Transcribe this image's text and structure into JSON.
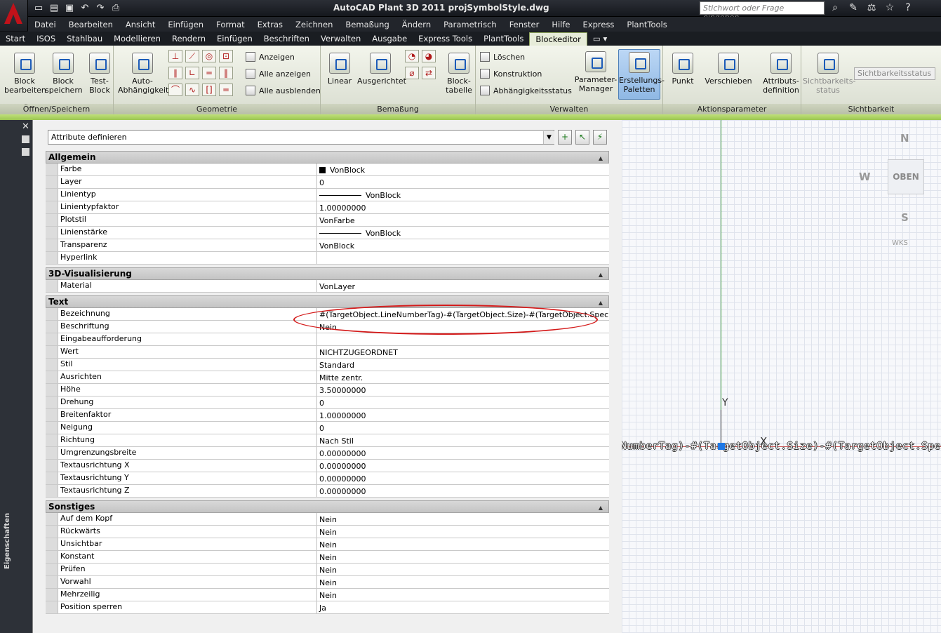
{
  "window": {
    "title": "AutoCAD Plant 3D 2011   projSymbolStyle.dwg",
    "search_placeholder": "Stichwort oder Frage eingeben"
  },
  "menu": [
    "Datei",
    "Bearbeiten",
    "Ansicht",
    "Einfügen",
    "Format",
    "Extras",
    "Zeichnen",
    "Bemaßung",
    "Ändern",
    "Parametrisch",
    "Fenster",
    "Hilfe",
    "Express",
    "PlantTools"
  ],
  "tabs": [
    "Start",
    "ISOS",
    "Stahlbau",
    "Modellieren",
    "Rendern",
    "Einfügen",
    "Beschriften",
    "Verwalten",
    "Ausgabe",
    "Express Tools",
    "PlantTools",
    "Blockeditor"
  ],
  "ribbon": {
    "block_edit": "Block bearbeiten",
    "block_save": "Block speichern",
    "test_block": "Test-Block",
    "auto_dep": "Auto-Abhängigkeit",
    "show": "Anzeigen",
    "show_all": "Alle anzeigen",
    "hide_all": "Alle ausblenden",
    "linear": "Linear",
    "aligned": "Ausgerichtet",
    "block_table": "Block-tabelle",
    "delete": "Löschen",
    "construction": "Konstruktion",
    "dep_status": "Abhängigkeitsstatus",
    "param_manager": "Parameter-Manager",
    "auth_palettes": "Erstellungs-Paletten",
    "point": "Punkt",
    "move": "Verschieben",
    "attr_def": "Attributs-definition",
    "vis_state": "Sichtbarkeits-status",
    "vis_combo": "Sichtbarkeitsstatus",
    "panel_open": "Öffnen/Speichern",
    "panel_geometry": "Geometrie",
    "panel_dim": "Bemaßung",
    "panel_manage": "Verwalten",
    "panel_action": "Aktionsparameter",
    "panel_vis": "Sichtbarkeit"
  },
  "palette": {
    "side_title": "Eigenschaften",
    "selector": "Attribute definieren",
    "categories": [
      {
        "name": "Allgemein",
        "rows": [
          {
            "name": "Farbe",
            "value": "VonBlock",
            "kind": "color"
          },
          {
            "name": "Layer",
            "value": "0"
          },
          {
            "name": "Linientyp",
            "value": "VonBlock",
            "kind": "line"
          },
          {
            "name": "Linientypfaktor",
            "value": "1.00000000"
          },
          {
            "name": "Plotstil",
            "value": "VonFarbe"
          },
          {
            "name": "Linienstärke",
            "value": "VonBlock",
            "kind": "line"
          },
          {
            "name": "Transparenz",
            "value": "VonBlock"
          },
          {
            "name": "Hyperlink",
            "value": ""
          }
        ]
      },
      {
        "name": "3D-Visualisierung",
        "rows": [
          {
            "name": "Material",
            "value": "VonLayer"
          }
        ]
      },
      {
        "name": "Text",
        "rows": [
          {
            "name": "Bezeichnung",
            "value": "#(TargetObject.LineNumberTag)-#(TargetObject.Size)-#(TargetObject.Spec)"
          },
          {
            "name": "Beschriftung",
            "value": "Nein"
          },
          {
            "name": "Eingabeaufforderung",
            "value": ""
          },
          {
            "name": "Wert",
            "value": "NICHTZUGEORDNET"
          },
          {
            "name": "Stil",
            "value": "Standard"
          },
          {
            "name": "Ausrichten",
            "value": "Mitte zentr."
          },
          {
            "name": "Höhe",
            "value": "3.50000000"
          },
          {
            "name": "Drehung",
            "value": "0"
          },
          {
            "name": "Breitenfaktor",
            "value": "1.00000000"
          },
          {
            "name": "Neigung",
            "value": "0"
          },
          {
            "name": "Richtung",
            "value": "Nach Stil"
          },
          {
            "name": "Umgrenzungsbreite",
            "value": "0.00000000"
          },
          {
            "name": "Textausrichtung X",
            "value": "0.00000000"
          },
          {
            "name": "Textausrichtung Y",
            "value": "0.00000000"
          },
          {
            "name": "Textausrichtung Z",
            "value": "0.00000000"
          }
        ]
      },
      {
        "name": "Sonstiges",
        "rows": [
          {
            "name": "Auf dem Kopf",
            "value": "Nein"
          },
          {
            "name": "Rückwärts",
            "value": "Nein"
          },
          {
            "name": "Unsichtbar",
            "value": "Nein"
          },
          {
            "name": "Konstant",
            "value": "Nein"
          },
          {
            "name": "Prüfen",
            "value": "Nein"
          },
          {
            "name": "Vorwahl",
            "value": "Nein"
          },
          {
            "name": "Mehrzeilig",
            "value": "Nein"
          },
          {
            "name": "Position sperren",
            "value": "Ja"
          }
        ]
      }
    ]
  },
  "viewport": {
    "north": "N",
    "west": "W",
    "south": "S",
    "cube_face": "OBEN",
    "ucs": "WKS",
    "y_axis": "Y",
    "x_axis": "X",
    "attr_text": "NumberTag)-#(TargetObject.Size)-#(TargetObject.Spec)"
  }
}
